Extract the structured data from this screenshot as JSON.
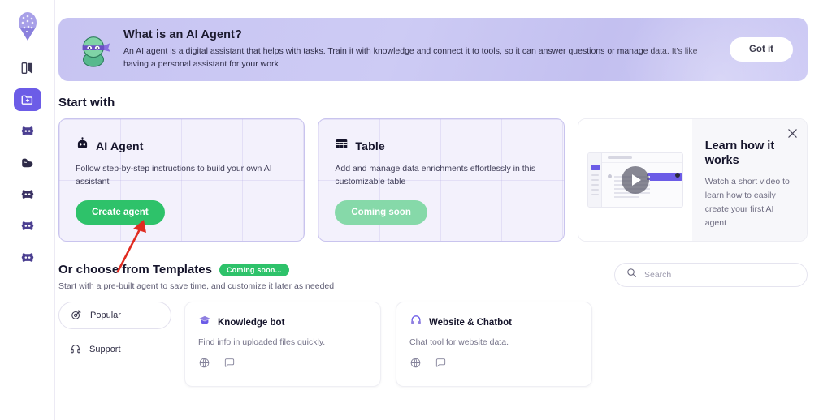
{
  "sidebar": {
    "logo_icon": "balloon-logo-icon",
    "items": [
      {
        "icon": "book-pages-icon",
        "active": false
      },
      {
        "icon": "folder-plus-icon",
        "active": true
      },
      {
        "icon": "bot-face-icon",
        "active": false
      },
      {
        "icon": "muscle-arm-icon",
        "active": false
      },
      {
        "icon": "bot-face-icon",
        "active": false
      },
      {
        "icon": "bot-face-icon",
        "active": false
      },
      {
        "icon": "bot-face-icon",
        "active": false
      }
    ]
  },
  "banner": {
    "mascot_icon": "ninja-mascot-icon",
    "title": "What is an AI Agent?",
    "body": "An AI agent is a digital assistant that helps with tasks. Train it with knowledge and connect it to tools, so it can answer questions or manage data. It's like having a personal assistant for your work",
    "dismiss_label": "Got it",
    "bg_color": "#c8c5f3"
  },
  "start": {
    "heading": "Start with",
    "cards": [
      {
        "icon": "robot-head-icon",
        "title": "AI Agent",
        "desc": "Follow step-by-step instructions to build your own AI assistant",
        "cta_label": "Create agent",
        "cta_color": "#2ec26a",
        "cta_enabled": true
      },
      {
        "icon": "table-grid-icon",
        "title": "Table",
        "desc": "Add and manage data enrichments effortlessly in this customizable table",
        "cta_label": "Coming soon",
        "cta_color": "#86d9a9",
        "cta_enabled": false
      }
    ]
  },
  "video_card": {
    "title": "Learn how it works",
    "desc": "Watch a short video to learn how to easily create your first AI agent",
    "play_icon": "play-button-icon",
    "close_icon": "close-icon"
  },
  "templates": {
    "heading": "Or choose from Templates",
    "badge": "Coming soon...",
    "badge_color": "#2ec26a",
    "subheading": "Start with a pre-built agent to save time, and customize it later as needed",
    "search": {
      "placeholder": "Search",
      "value": "",
      "icon": "search-icon"
    },
    "filters": [
      {
        "label": "Popular",
        "icon": "target-icon",
        "selected": true
      },
      {
        "label": "Support",
        "icon": "headphones-icon",
        "selected": false
      }
    ],
    "cards": [
      {
        "icon": "graduation-cap-icon",
        "title": "Knowledge bot",
        "desc": "Find info in uploaded files quickly.",
        "channels": [
          "globe-icon",
          "chat-bubble-icon"
        ]
      },
      {
        "icon": "headset-icon",
        "title": "Website & Chatbot",
        "desc": "Chat tool for website data.",
        "channels": [
          "globe-icon",
          "chat-bubble-icon"
        ]
      }
    ]
  },
  "annotation": {
    "arrow_color": "#e02b20",
    "points_to": "Create agent"
  }
}
